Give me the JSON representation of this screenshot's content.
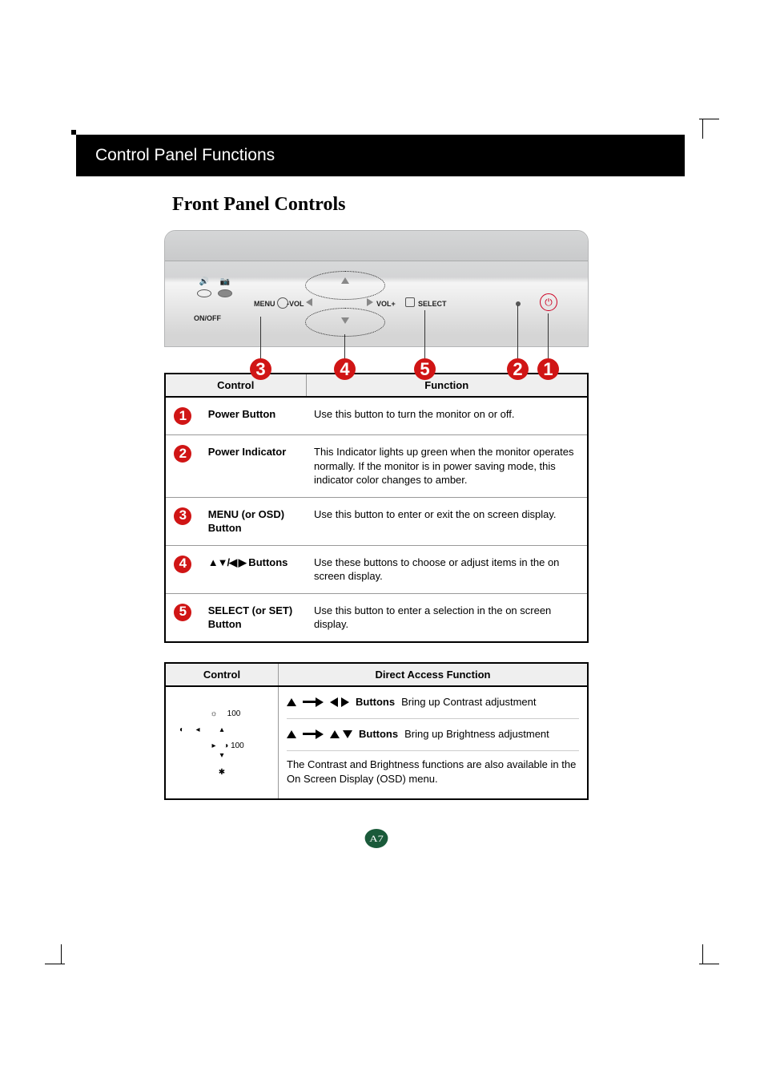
{
  "header": {
    "title": "Control Panel Functions"
  },
  "section": {
    "title": "Front Panel Controls"
  },
  "diagram": {
    "labels": {
      "onoff": "ON/OFF",
      "menu": "MENU",
      "volm": "-VOL",
      "volp": "VOL+",
      "select": "SELECT"
    },
    "callouts": [
      "1",
      "2",
      "3",
      "4",
      "5"
    ]
  },
  "table1": {
    "headers": {
      "control": "Control",
      "function": "Function"
    },
    "rows": [
      {
        "num": "1",
        "control": "Power Button",
        "function": "Use this button to turn the monitor on or off."
      },
      {
        "num": "2",
        "control": "Power Indicator",
        "function": "This Indicator lights up green when the monitor operates normally. If the monitor is in power saving mode, this indicator color changes to amber."
      },
      {
        "num": "3",
        "control": "MENU (or OSD) Button",
        "function": "Use this button to enter or exit the on screen display."
      },
      {
        "num": "4",
        "control_symbols": "▲▼/◀ ▶",
        "control_suffix": " Buttons",
        "function": "Use these buttons to choose or adjust items in the on screen display."
      },
      {
        "num": "5",
        "control": "SELECT (or SET) Button",
        "function": "Use this button to enter a selection in the on screen display."
      }
    ]
  },
  "table2": {
    "headers": {
      "control": "Control",
      "function": "Direct Access Function"
    },
    "diagram_values": {
      "sun": "100",
      "moon": "100"
    },
    "rows": [
      {
        "buttons_label": "Buttons",
        "desc": "Bring up Contrast adjustment"
      },
      {
        "buttons_label": "Buttons",
        "desc": "Bring up Brightness adjustment"
      }
    ],
    "note": "The Contrast and Brightness functions are also available in the On Screen Display (OSD) menu."
  },
  "page_number": "A7"
}
